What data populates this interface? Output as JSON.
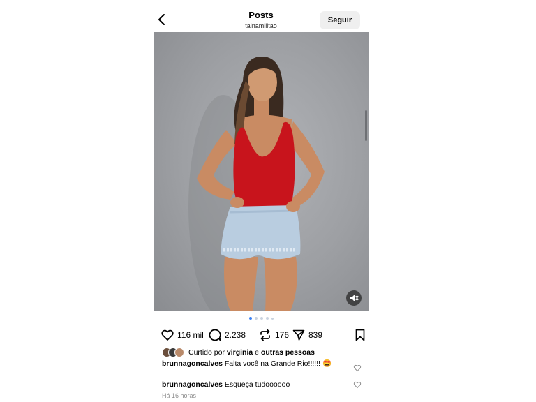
{
  "header": {
    "title": "Posts",
    "username": "tainamilitao",
    "follow_label": "Seguir",
    "back_icon": "chevron-left-icon"
  },
  "post": {
    "carousel": {
      "total": 5,
      "active_index": 0
    },
    "mute_icon": "speaker-muted-icon"
  },
  "actions": {
    "likes": "116 mil",
    "comments": "2.238",
    "reposts": "176",
    "shares": "839"
  },
  "liked_by": {
    "prefix": "Curtido por",
    "user": "virginia",
    "connector": "e",
    "others": "outras pessoas"
  },
  "comments": [
    {
      "user": "brunnagoncalves",
      "text": "Falta você na Grande Rio!!!!!! 🤩"
    },
    {
      "user": "brunnagoncalves",
      "text": "Esqueça tudoooooo"
    }
  ],
  "timestamp": "Há 16 horas",
  "colors": {
    "accent": "#3b82f6",
    "top_red": "#c8141c",
    "background_gray": "#9d9fa3"
  }
}
